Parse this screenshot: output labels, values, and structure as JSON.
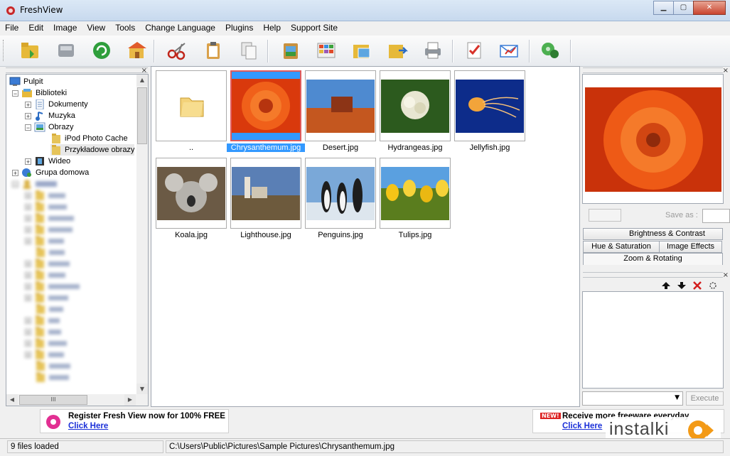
{
  "window": {
    "title": "FreshView",
    "minimize": "▁",
    "maximize": "▢",
    "close": "✕"
  },
  "menu": [
    "File",
    "Edit",
    "Image",
    "View",
    "Tools",
    "Change Language",
    "Plugins",
    "Help",
    "Support Site"
  ],
  "toolbar": {
    "icons": [
      "open-folder-icon",
      "scanner-icon",
      "refresh-icon",
      "home-icon",
      "cut-icon",
      "paste-icon",
      "copy-icon",
      "clipboard-image-icon",
      "slideshow-icon",
      "folder-images-icon",
      "export-folder-icon",
      "print-icon",
      "checklist-icon",
      "email-icon",
      "plugins-icon"
    ]
  },
  "tree": {
    "close": "×",
    "items": [
      {
        "label": "Pulpit",
        "expander": "",
        "indent": 0
      },
      {
        "label": "Biblioteki",
        "expander": "−",
        "indent": 1
      },
      {
        "label": "Dokumenty",
        "expander": "+",
        "indent": 2
      },
      {
        "label": "Muzyka",
        "expander": "+",
        "indent": 2
      },
      {
        "label": "Obrazy",
        "expander": "−",
        "indent": 2
      },
      {
        "label": "iPod Photo Cache",
        "expander": "",
        "indent": 3
      },
      {
        "label": "Przykładowe obrazy",
        "expander": "",
        "indent": 3
      },
      {
        "label": "Wideo",
        "expander": "+",
        "indent": 2
      },
      {
        "label": "Grupa domowa",
        "expander": "+",
        "indent": 1
      }
    ],
    "hscroll_thumb": "III"
  },
  "thumbnails": [
    {
      "label": "..",
      "selected": false
    },
    {
      "label": "Chrysanthemum.jpg",
      "selected": true
    },
    {
      "label": "Desert.jpg",
      "selected": false
    },
    {
      "label": "Hydrangeas.jpg",
      "selected": false
    },
    {
      "label": "Jellyfish.jpg",
      "selected": false
    },
    {
      "label": "Koala.jpg",
      "selected": false
    },
    {
      "label": "Lighthouse.jpg",
      "selected": false
    },
    {
      "label": "Penguins.jpg",
      "selected": false
    },
    {
      "label": "Tulips.jpg",
      "selected": false
    }
  ],
  "right_panel": {
    "save_as_label": "Save as :",
    "tabs": [
      "Brightness & Contrast",
      "Hue & Saturation",
      "Image Effects",
      "Zoom & Rotating"
    ],
    "tools": [
      "up-arrow-icon",
      "down-arrow-icon",
      "delete-icon",
      "settings-icon"
    ],
    "execute_label": "Execute",
    "close": "×"
  },
  "ads": {
    "left_text": "Register Fresh View now for 100% FREE",
    "left_link": "Click Here",
    "right_badge": "NEW!",
    "right_text": "Receive more freeware everyday",
    "right_link": "Click Here"
  },
  "status": {
    "files_loaded": "9 files loaded",
    "path": "C:\\Users\\Public\\Pictures\\Sample Pictures\\Chrysanthemum.jpg"
  },
  "watermark": "instalki"
}
